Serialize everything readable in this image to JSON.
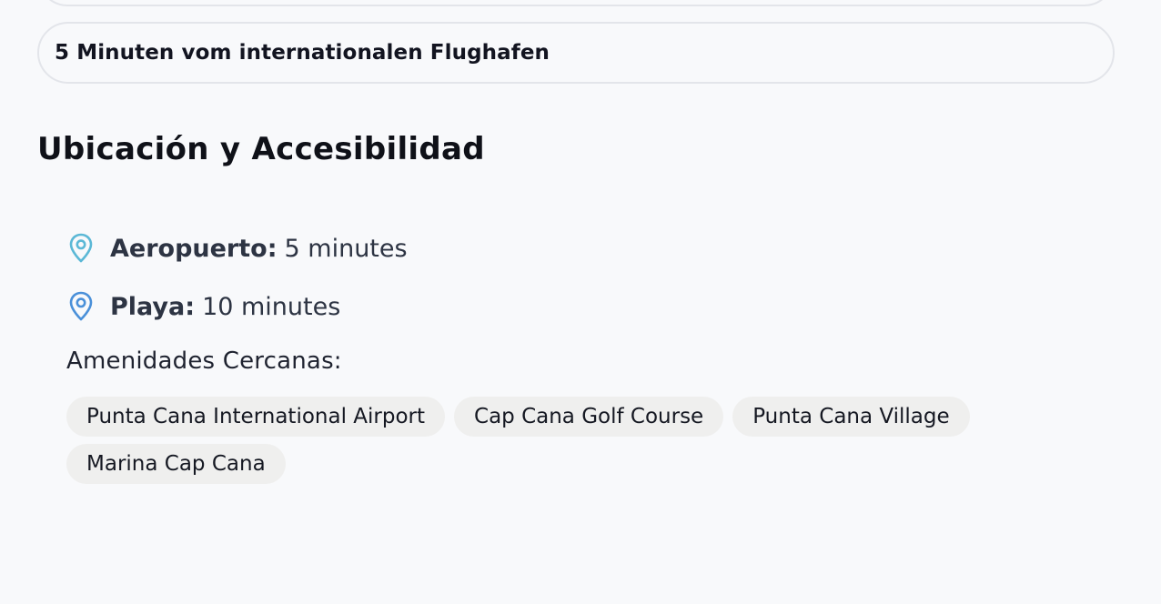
{
  "features": {
    "airport_distance": "5 Minuten vom internationalen Flughafen"
  },
  "location_section": {
    "title": "Ubicación y Accesibilidad",
    "items": [
      {
        "label": "Aeropuerto:",
        "value": "5 minutes",
        "icon": "map-pin-icon",
        "icon_color": "#5bb8d6"
      },
      {
        "label": "Playa:",
        "value": "10 minutes",
        "icon": "map-pin-icon",
        "icon_color": "#4a90d9"
      }
    ],
    "amenities_heading": "Amenidades Cercanas:",
    "amenities": [
      "Punta Cana International Airport",
      "Cap Cana Golf Course",
      "Punta Cana Village",
      "Marina Cap Cana"
    ]
  }
}
